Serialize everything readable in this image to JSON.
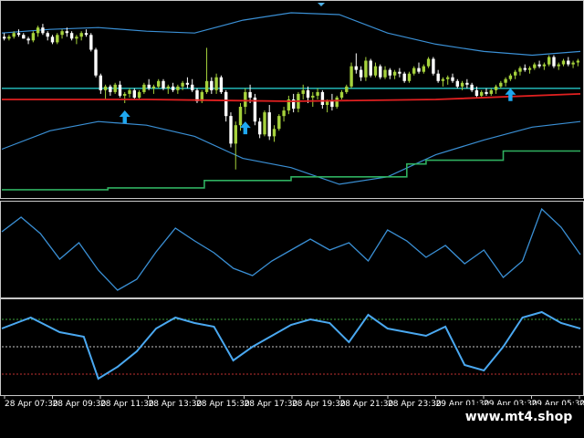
{
  "watermark": "www.mt4.shop",
  "colors": {
    "background": "#000000",
    "frame": "#c8c8c8",
    "bull": "#a6d23c",
    "bear": "#ffffff",
    "bands": "#3a8fd4",
    "redLine": "#e02020",
    "tealLine": "#25c6c6",
    "greenStep": "#2fb060",
    "arrows": "#1fa8f0",
    "osc1": "#3a8fd4",
    "osc2": "#4aa8f0",
    "levelHigh": "#3ca03c",
    "levelMid": "#c8c8c8",
    "levelLow": "#c03030"
  },
  "chart_data": [
    {
      "type": "candlestick",
      "panel": "price",
      "ylim": [
        0,
        100
      ],
      "grid": false,
      "x_count": 120,
      "candles": [
        [
          86,
          88,
          84,
          85
        ],
        [
          85,
          87,
          84,
          86
        ],
        [
          86,
          89,
          85,
          88
        ],
        [
          88,
          90,
          86,
          87
        ],
        [
          87,
          88,
          85,
          85
        ],
        [
          85,
          86,
          82,
          84
        ],
        [
          84,
          89,
          83,
          88
        ],
        [
          88,
          92,
          86,
          91
        ],
        [
          91,
          93,
          87,
          88
        ],
        [
          88,
          89,
          84,
          86
        ],
        [
          86,
          87,
          82,
          83
        ],
        [
          83,
          88,
          82,
          87
        ],
        [
          87,
          90,
          85,
          89
        ],
        [
          89,
          91,
          86,
          88
        ],
        [
          88,
          89,
          84,
          85
        ],
        [
          85,
          87,
          82,
          86
        ],
        [
          86,
          89,
          84,
          88
        ],
        [
          88,
          90,
          86,
          87
        ],
        [
          87,
          88,
          78,
          79
        ],
        [
          79,
          80,
          64,
          65
        ],
        [
          65,
          66,
          55,
          57
        ],
        [
          57,
          60,
          52,
          59
        ],
        [
          59,
          60,
          54,
          56
        ],
        [
          56,
          61,
          55,
          60
        ],
        [
          60,
          62,
          53,
          54
        ],
        [
          54,
          56,
          50,
          55
        ],
        [
          55,
          58,
          53,
          57
        ],
        [
          57,
          58,
          52,
          53
        ],
        [
          53,
          57,
          52,
          56
        ],
        [
          56,
          61,
          55,
          60
        ],
        [
          60,
          63,
          57,
          58
        ],
        [
          58,
          60,
          55,
          59
        ],
        [
          59,
          63,
          58,
          62
        ],
        [
          62,
          63,
          57,
          58
        ],
        [
          58,
          60,
          55,
          59
        ],
        [
          59,
          61,
          56,
          57
        ],
        [
          57,
          60,
          55,
          59
        ],
        [
          59,
          62,
          57,
          61
        ],
        [
          61,
          64,
          58,
          60
        ],
        [
          60,
          63,
          56,
          57
        ],
        [
          57,
          58,
          50,
          51
        ],
        [
          51,
          57,
          50,
          56
        ],
        [
          56,
          80,
          55,
          62
        ],
        [
          62,
          64,
          55,
          57
        ],
        [
          57,
          66,
          55,
          64
        ],
        [
          64,
          65,
          55,
          56
        ],
        [
          56,
          57,
          40,
          43
        ],
        [
          43,
          45,
          26,
          28
        ],
        [
          28,
          40,
          14,
          38
        ],
        [
          38,
          50,
          35,
          48
        ],
        [
          48,
          58,
          44,
          56
        ],
        [
          56,
          60,
          50,
          53
        ],
        [
          53,
          55,
          38,
          40
        ],
        [
          40,
          42,
          31,
          33
        ],
        [
          33,
          46,
          32,
          45
        ],
        [
          45,
          49,
          30,
          32
        ],
        [
          32,
          38,
          29,
          36
        ],
        [
          36,
          44,
          35,
          43
        ],
        [
          43,
          48,
          40,
          46
        ],
        [
          46,
          54,
          44,
          52
        ],
        [
          52,
          55,
          45,
          47
        ],
        [
          47,
          56,
          45,
          55
        ],
        [
          55,
          60,
          52,
          57
        ],
        [
          57,
          59,
          50,
          53
        ],
        [
          53,
          56,
          48,
          54
        ],
        [
          54,
          58,
          52,
          56
        ],
        [
          56,
          57,
          47,
          49
        ],
        [
          49,
          52,
          45,
          51
        ],
        [
          51,
          55,
          46,
          48
        ],
        [
          48,
          54,
          47,
          53
        ],
        [
          53,
          57,
          52,
          56
        ],
        [
          56,
          60,
          55,
          59
        ],
        [
          59,
          72,
          58,
          70
        ],
        [
          70,
          77,
          66,
          68
        ],
        [
          68,
          70,
          62,
          64
        ],
        [
          64,
          75,
          62,
          73
        ],
        [
          73,
          74,
          64,
          65
        ],
        [
          65,
          72,
          64,
          70
        ],
        [
          70,
          71,
          63,
          64
        ],
        [
          64,
          70,
          63,
          68
        ],
        [
          68,
          69,
          63,
          65
        ],
        [
          65,
          68,
          63,
          67
        ],
        [
          67,
          69,
          64,
          66
        ],
        [
          66,
          67,
          61,
          62
        ],
        [
          62,
          67,
          61,
          66
        ],
        [
          66,
          70,
          65,
          69
        ],
        [
          69,
          72,
          66,
          67
        ],
        [
          67,
          71,
          66,
          70
        ],
        [
          70,
          75,
          69,
          74
        ],
        [
          74,
          75,
          65,
          66
        ],
        [
          66,
          68,
          61,
          62
        ],
        [
          62,
          64,
          59,
          63
        ],
        [
          63,
          65,
          60,
          64
        ],
        [
          64,
          66,
          61,
          62
        ],
        [
          62,
          63,
          58,
          59
        ],
        [
          59,
          62,
          57,
          61
        ],
        [
          61,
          63,
          58,
          60
        ],
        [
          60,
          61,
          56,
          57
        ],
        [
          57,
          59,
          53,
          54
        ],
        [
          54,
          57,
          53,
          56
        ],
        [
          56,
          58,
          54,
          55
        ],
        [
          55,
          58,
          54,
          57
        ],
        [
          57,
          60,
          55,
          59
        ],
        [
          59,
          62,
          58,
          61
        ],
        [
          61,
          64,
          59,
          63
        ],
        [
          63,
          66,
          62,
          65
        ],
        [
          65,
          68,
          63,
          67
        ],
        [
          67,
          70,
          65,
          69
        ],
        [
          69,
          71,
          67,
          68
        ],
        [
          68,
          70,
          66,
          69
        ],
        [
          69,
          72,
          68,
          71
        ],
        [
          71,
          73,
          69,
          70
        ],
        [
          70,
          72,
          68,
          71
        ],
        [
          71,
          76,
          70,
          75
        ],
        [
          75,
          76,
          69,
          70
        ],
        [
          70,
          72,
          68,
          71
        ],
        [
          71,
          74,
          70,
          73
        ],
        [
          73,
          75,
          70,
          71
        ],
        [
          71,
          73,
          69,
          72
        ],
        [
          72,
          74,
          70,
          73
        ]
      ],
      "upper_band": [
        [
          0,
          88
        ],
        [
          10,
          90
        ],
        [
          20,
          91
        ],
        [
          30,
          89
        ],
        [
          40,
          88
        ],
        [
          50,
          95
        ],
        [
          60,
          99
        ],
        [
          70,
          98
        ],
        [
          80,
          88
        ],
        [
          90,
          82
        ],
        [
          100,
          78
        ],
        [
          110,
          76
        ],
        [
          120,
          78
        ]
      ],
      "lower_band": [
        [
          0,
          25
        ],
        [
          10,
          35
        ],
        [
          20,
          40
        ],
        [
          30,
          38
        ],
        [
          40,
          32
        ],
        [
          50,
          20
        ],
        [
          60,
          15
        ],
        [
          70,
          6
        ],
        [
          80,
          10
        ],
        [
          90,
          22
        ],
        [
          100,
          30
        ],
        [
          110,
          37
        ],
        [
          120,
          40
        ]
      ],
      "red_line": [
        [
          0,
          52
        ],
        [
          30,
          52
        ],
        [
          60,
          51
        ],
        [
          90,
          52
        ],
        [
          120,
          55
        ]
      ],
      "teal_line": [
        [
          0,
          58
        ],
        [
          120,
          58
        ]
      ],
      "green_step": [
        [
          0,
          3
        ],
        [
          22,
          3
        ],
        [
          22,
          4
        ],
        [
          42,
          4
        ],
        [
          42,
          8
        ],
        [
          60,
          8
        ],
        [
          60,
          10
        ],
        [
          84,
          10
        ],
        [
          84,
          17
        ],
        [
          88,
          17
        ],
        [
          88,
          19
        ],
        [
          104,
          19
        ],
        [
          104,
          24
        ],
        [
          120,
          24
        ]
      ],
      "arrows": [
        25,
        50,
        105
      ]
    },
    {
      "type": "line",
      "panel": "oscillator-1",
      "ylim": [
        0,
        100
      ],
      "series": [
        {
          "values": [
            [
              0,
              70
            ],
            [
              4,
              86
            ],
            [
              8,
              68
            ],
            [
              12,
              40
            ],
            [
              16,
              58
            ],
            [
              20,
              28
            ],
            [
              24,
              6
            ],
            [
              28,
              18
            ],
            [
              32,
              48
            ],
            [
              36,
              74
            ],
            [
              40,
              60
            ],
            [
              44,
              47
            ],
            [
              48,
              30
            ],
            [
              52,
              22
            ],
            [
              56,
              38
            ],
            [
              60,
              50
            ],
            [
              64,
              62
            ],
            [
              68,
              50
            ],
            [
              72,
              58
            ],
            [
              76,
              38
            ],
            [
              80,
              72
            ],
            [
              84,
              60
            ],
            [
              88,
              42
            ],
            [
              92,
              55
            ],
            [
              96,
              35
            ],
            [
              100,
              50
            ],
            [
              104,
              20
            ],
            [
              108,
              38
            ],
            [
              112,
              95
            ],
            [
              116,
              75
            ],
            [
              120,
              45
            ]
          ]
        }
      ]
    },
    {
      "type": "line",
      "panel": "oscillator-2",
      "ylim": [
        0,
        100
      ],
      "levels": [
        80,
        50,
        20
      ],
      "series": [
        {
          "values": [
            [
              0,
              70
            ],
            [
              6,
              82
            ],
            [
              12,
              66
            ],
            [
              17,
              61
            ],
            [
              20,
              15
            ],
            [
              24,
              28
            ],
            [
              28,
              45
            ],
            [
              32,
              70
            ],
            [
              36,
              82
            ],
            [
              40,
              76
            ],
            [
              44,
              72
            ],
            [
              48,
              35
            ],
            [
              52,
              50
            ],
            [
              56,
              62
            ],
            [
              60,
              74
            ],
            [
              64,
              80
            ],
            [
              68,
              76
            ],
            [
              72,
              55
            ],
            [
              76,
              85
            ],
            [
              80,
              70
            ],
            [
              84,
              66
            ],
            [
              88,
              62
            ],
            [
              92,
              72
            ],
            [
              96,
              30
            ],
            [
              100,
              24
            ],
            [
              104,
              50
            ],
            [
              108,
              82
            ],
            [
              112,
              88
            ],
            [
              116,
              76
            ],
            [
              120,
              70
            ]
          ]
        }
      ]
    }
  ],
  "x_axis": {
    "labels": [
      "28 Apr 07:30",
      "28 Apr 09:30",
      "28 Apr 11:30",
      "28 Apr 13:30",
      "28 Apr 15:30",
      "28 Apr 17:30",
      "28 Apr 19:30",
      "28 Apr 21:30",
      "28 Apr 23:30",
      "29 Apr 01:30",
      "29 Apr 03:30",
      "29 Apr 05:30",
      "29 A"
    ]
  }
}
